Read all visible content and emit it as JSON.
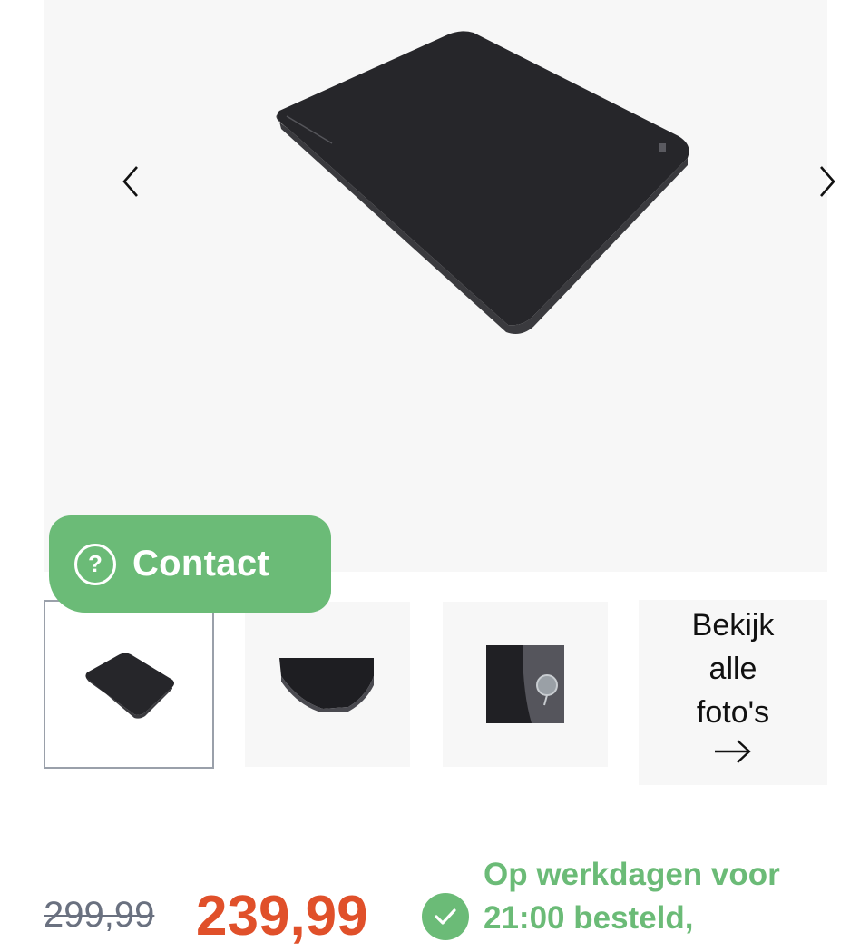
{
  "gallery": {
    "prev_icon": "chevron-left-icon",
    "next_icon": "chevron-right-icon",
    "thumbnails": [
      "mattress-top-view",
      "mattress-corner-detail",
      "mattress-valve-detail"
    ],
    "view_all": {
      "line1": "Bekijk",
      "line2": "alle",
      "line3": "foto's",
      "icon": "arrow-right-icon"
    }
  },
  "contact": {
    "icon": "question-circle-icon",
    "label": "Contact",
    "color": "#6bbb77"
  },
  "price": {
    "old": "299,99",
    "new": "239,99",
    "new_color": "#e0502a"
  },
  "delivery": {
    "icon": "check-circle-icon",
    "line1": "Op werkdagen voor",
    "line2": "21:00 besteld,",
    "color": "#6bbb77"
  }
}
